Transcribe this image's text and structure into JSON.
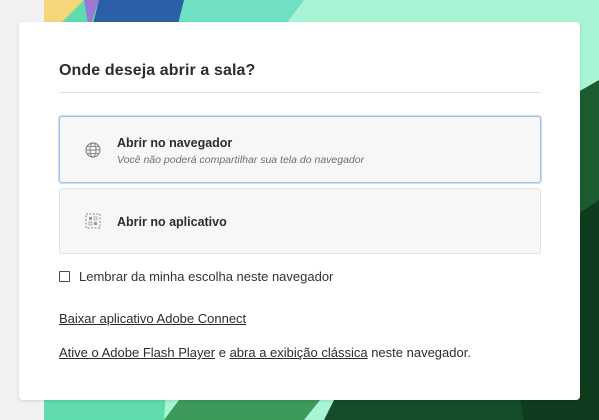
{
  "dialog": {
    "title": "Onde deseja abrir a sala?",
    "options": [
      {
        "label": "Abrir no navegador",
        "sublabel": "Você não poderá compartilhar sua tela do navegador",
        "icon": "globe-icon",
        "selected": true
      },
      {
        "label": "Abrir no aplicativo",
        "icon": "application-icon",
        "selected": false
      }
    ],
    "remember": {
      "label": "Lembrar da minha escolha neste navegador",
      "checked": false
    },
    "download_link": "Baixar aplicativo Adobe Connect",
    "flash_line": {
      "link1": "Ative o Adobe Flash Player",
      "conj": " e ",
      "link2": "abra a exibição clássica",
      "suffix": " neste navegador."
    }
  },
  "colors": {
    "selected_border": "#9fc0e8",
    "background_teal": "#6fe0b6",
    "background_dark_green": "#0f3b1f"
  }
}
